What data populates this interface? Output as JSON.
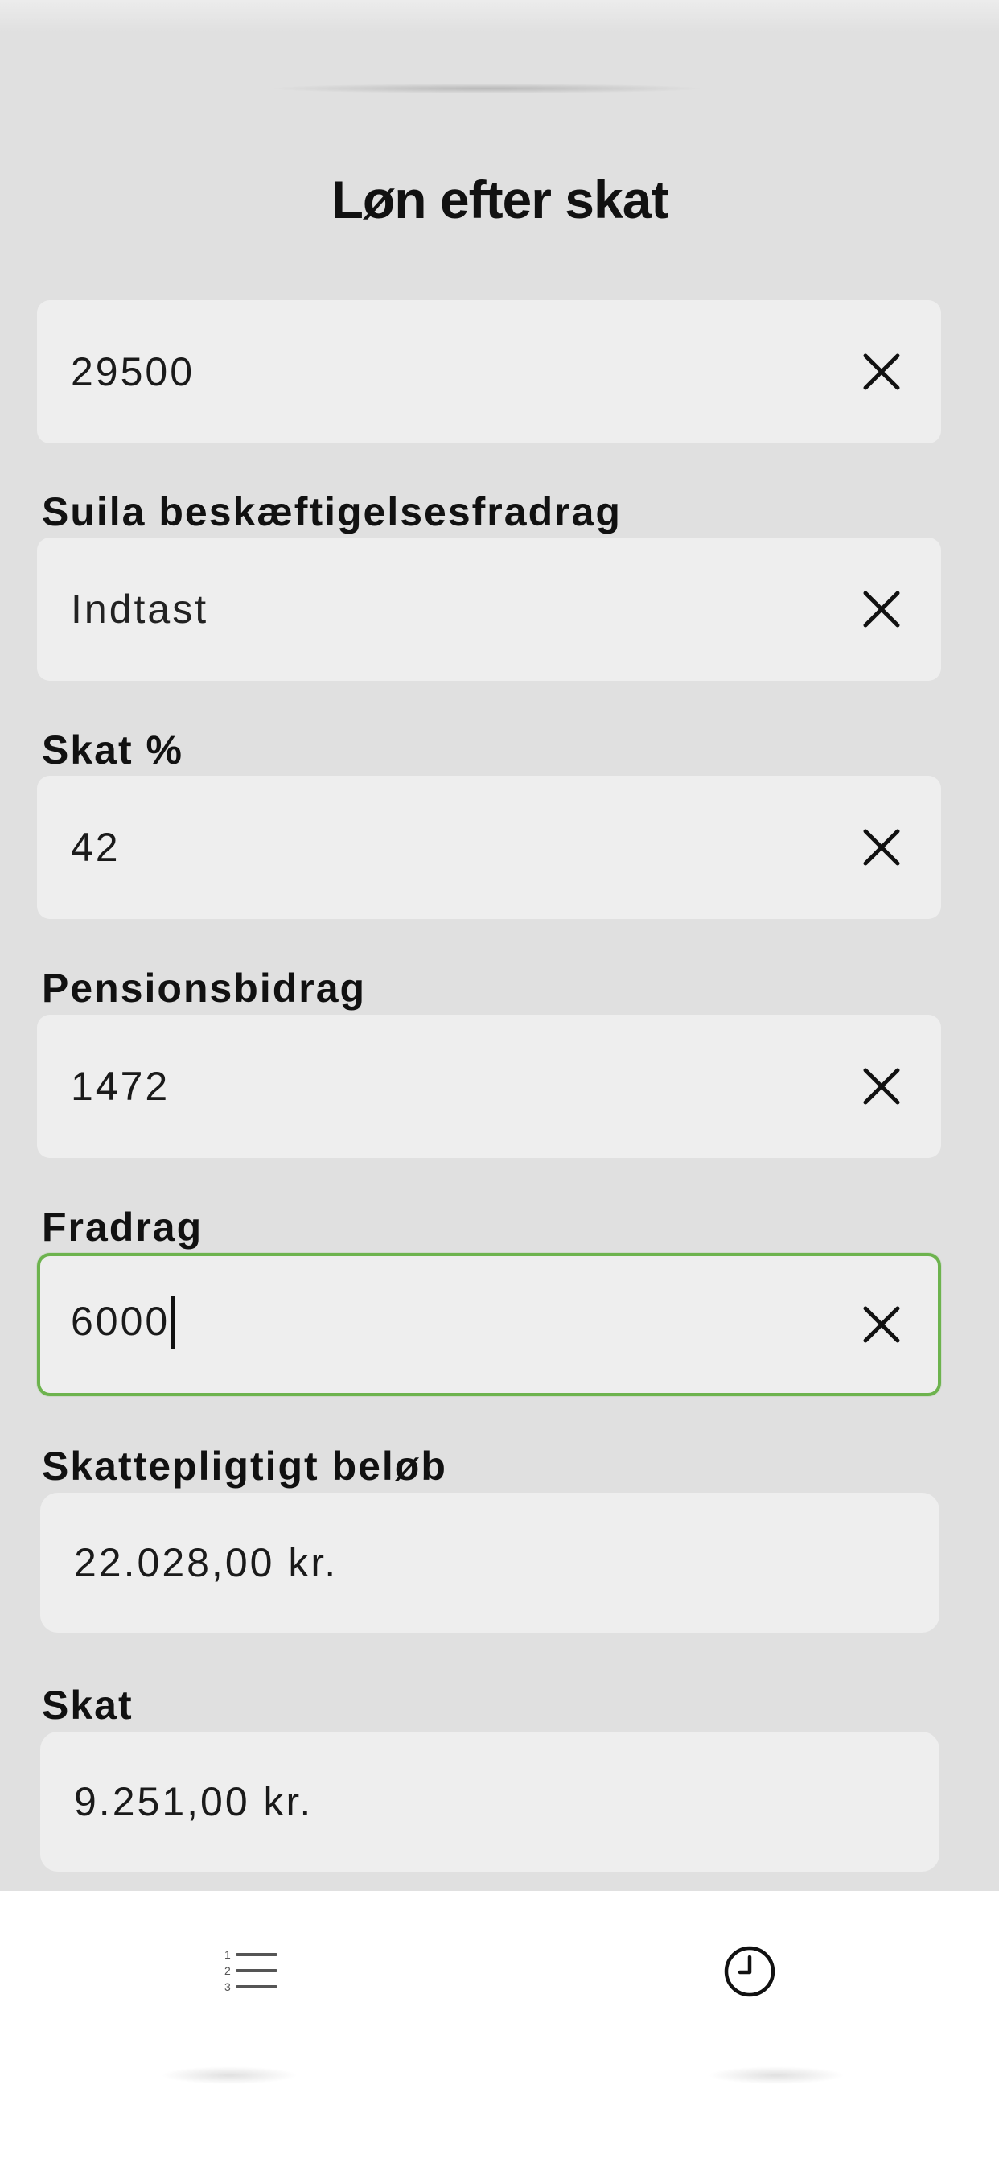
{
  "header": {
    "title": "Løn efter skat"
  },
  "form": {
    "salary": {
      "value": "29500"
    },
    "suila": {
      "label": "Suila beskæftigelsesfradrag",
      "placeholder": "Indtast"
    },
    "tax_percent": {
      "label": "Skat %",
      "value": "42"
    },
    "pension": {
      "label": "Pensionsbidrag",
      "value": "1472"
    },
    "deduction": {
      "label": "Fradrag",
      "value": "6000"
    }
  },
  "results": {
    "taxable": {
      "label": "Skattepligtigt beløb",
      "value": "22.028,00 kr."
    },
    "tax": {
      "label": "Skat",
      "value": "9.251,00 kr."
    }
  },
  "tabbar": {
    "items": [
      {
        "icon": "numbered-list-icon"
      },
      {
        "icon": "clock-icon"
      }
    ]
  },
  "colors": {
    "background": "#e0e0e0",
    "field": "#eeeeee",
    "active_border": "#6db34e",
    "tabbar": "#ffffff"
  }
}
